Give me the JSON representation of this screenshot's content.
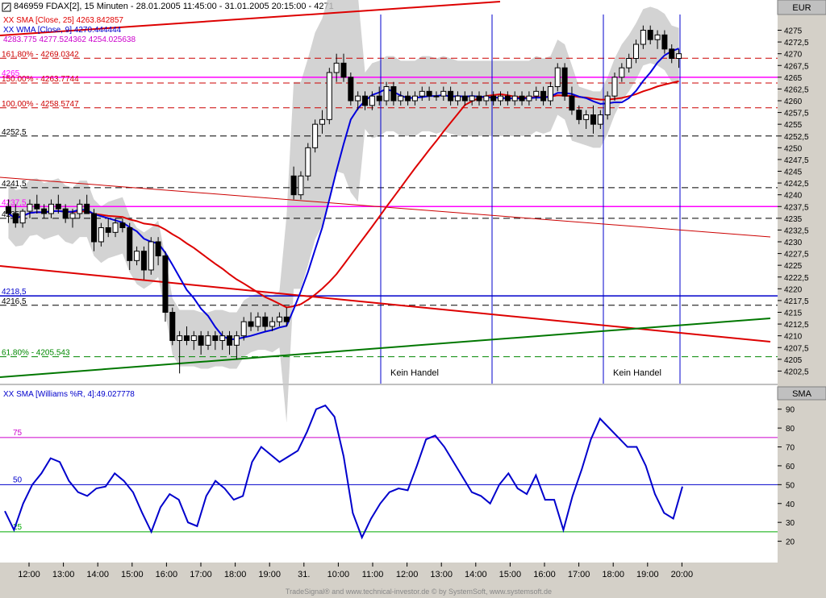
{
  "header": {
    "icon": "chart-icon",
    "title": "846959  FDAX[2], 15 Minuten - 28.01.2005 11:45:00 - 31.01.2005 20:15:00 - 4271"
  },
  "currency_label": "EUR",
  "lower_panel_label": "SMA",
  "footer_text": "TradeSignal® and www.technical-investor.de © by SystemSoft, www.systemsoft.de",
  "chart_data": [
    {
      "type": "candlestick",
      "panel": "price",
      "ylim": [
        4200,
        4278
      ],
      "y_ticks": [
        "4275",
        "4272,5",
        "4270",
        "4267,5",
        "4265",
        "4262,5",
        "4260",
        "4257,5",
        "4255",
        "4252,5",
        "4250",
        "4247,5",
        "4245",
        "4242,5",
        "4240",
        "4237,5",
        "4235",
        "4232,5",
        "4230",
        "4227,5",
        "4225",
        "4222,5",
        "4220",
        "4217,5",
        "4215",
        "4212,5",
        "4210",
        "4207,5",
        "4205",
        "4202,5"
      ],
      "y_tick_values": [
        4275,
        4272.5,
        4270,
        4267.5,
        4265,
        4262.5,
        4260,
        4257.5,
        4255,
        4252.5,
        4250,
        4247.5,
        4245,
        4242.5,
        4240,
        4237.5,
        4235,
        4232.5,
        4230,
        4227.5,
        4225,
        4222.5,
        4220,
        4217.5,
        4215,
        4212.5,
        4210,
        4207.5,
        4205,
        4202.5
      ],
      "indicator_labels": [
        {
          "text": "XX SMA [Close, 25] 4263.842857",
          "color": "#e00000"
        },
        {
          "text": "XX WMA [Close, 9] 4270.444444",
          "color": "#0000cc"
        },
        {
          "text": "4283.775  4277.524362  4254.025638",
          "color": "#cc00cc"
        }
      ],
      "levels": [
        {
          "value": 4269.0342,
          "label": "161,80% - 4269.0342",
          "color": "#cc0000",
          "style": "dash"
        },
        {
          "value": 4265,
          "label": "4265",
          "color": "#ff00ff",
          "style": "solid"
        },
        {
          "value": 4263.7744,
          "label": "150.00% - 4263.7744",
          "color": "#cc0000",
          "style": "dash"
        },
        {
          "value": 4258.5,
          "label": "100.00% - 4258.5747",
          "color": "#cc0000",
          "style": "dash"
        },
        {
          "value": 4252.5,
          "label": "4252,5",
          "color": "#000000",
          "style": "dash"
        },
        {
          "value": 4241.5,
          "label": "4241,5",
          "color": "#000000",
          "style": "dash"
        },
        {
          "value": 4237.5,
          "label": "4237,5",
          "color": "#ff00ff",
          "style": "solid"
        },
        {
          "value": 4235,
          "label": "4235",
          "color": "#000000",
          "style": "dash"
        },
        {
          "value": 4218.5,
          "label": "4218,5",
          "color": "#0000cc",
          "style": "solid"
        },
        {
          "value": 4216.5,
          "label": "4216,5",
          "color": "#000000",
          "style": "dash"
        },
        {
          "value": 4205.543,
          "label": "61.80% - 4205.543",
          "color": "#008800",
          "style": "dash"
        }
      ],
      "session_labels": [
        "Kein Handel",
        "Kein Handel"
      ],
      "candles": [
        [
          4237.5,
          4239,
          4234,
          4236
        ],
        [
          4236,
          4238,
          4233,
          4234
        ],
        [
          4234,
          4237,
          4233,
          4236.5
        ],
        [
          4236.5,
          4239,
          4235,
          4238
        ],
        [
          4238,
          4240,
          4236,
          4237
        ],
        [
          4237,
          4238,
          4235,
          4236
        ],
        [
          4236,
          4239,
          4235,
          4238
        ],
        [
          4238,
          4240,
          4236,
          4237
        ],
        [
          4237,
          4238,
          4234,
          4235
        ],
        [
          4235,
          4237,
          4233,
          4236
        ],
        [
          4236,
          4239,
          4235,
          4238
        ],
        [
          4238,
          4240,
          4236,
          4236
        ],
        [
          4236,
          4237,
          4228,
          4230
        ],
        [
          4230,
          4234,
          4229,
          4233
        ],
        [
          4233,
          4235,
          4231,
          4232
        ],
        [
          4232,
          4235,
          4231,
          4234
        ],
        [
          4234,
          4235,
          4232,
          4233
        ],
        [
          4233,
          4234,
          4224,
          4226
        ],
        [
          4226,
          4229,
          4225,
          4228
        ],
        [
          4228,
          4229,
          4222,
          4224
        ],
        [
          4224,
          4231,
          4223,
          4230
        ],
        [
          4230,
          4231,
          4225,
          4227
        ],
        [
          4227,
          4228,
          4213,
          4215
        ],
        [
          4215,
          4216,
          4208,
          4209
        ],
        [
          4209,
          4211,
          4202,
          4210
        ],
        [
          4210,
          4212,
          4208,
          4209
        ],
        [
          4209,
          4211,
          4207,
          4210
        ],
        [
          4210,
          4211,
          4206,
          4208
        ],
        [
          4208,
          4211,
          4207,
          4210
        ],
        [
          4210,
          4211,
          4207,
          4209
        ],
        [
          4209,
          4211,
          4207,
          4210
        ],
        [
          4210,
          4211,
          4206,
          4208
        ],
        [
          4208,
          4211,
          4205,
          4210
        ],
        [
          4210,
          4214,
          4209,
          4213
        ],
        [
          4213,
          4215,
          4211,
          4212
        ],
        [
          4212,
          4215,
          4211,
          4214
        ],
        [
          4214,
          4215,
          4211,
          4212
        ],
        [
          4212,
          4214,
          4211,
          4213
        ],
        [
          4213,
          4215,
          4212,
          4214
        ],
        [
          4214,
          4216,
          4212,
          4213
        ],
        [
          4244,
          4246,
          4239,
          4240
        ],
        [
          4240,
          4245,
          4239,
          4244
        ],
        [
          4244,
          4251,
          4243,
          4250
        ],
        [
          4250,
          4256,
          4249,
          4255
        ],
        [
          4255,
          4258,
          4253,
          4256
        ],
        [
          4256,
          4267,
          4255,
          4266
        ],
        [
          4266,
          4270,
          4264,
          4268
        ],
        [
          4268,
          4270,
          4264,
          4265
        ],
        [
          4265,
          4266,
          4259,
          4260
        ],
        [
          4260,
          4262,
          4258,
          4261
        ],
        [
          4261,
          4262,
          4258,
          4259
        ],
        [
          4259,
          4262,
          4258,
          4261
        ],
        [
          4261,
          4263,
          4259,
          4260
        ],
        [
          4260,
          4264,
          4259,
          4263
        ],
        [
          4263,
          4264,
          4259,
          4260
        ],
        [
          4260,
          4262,
          4259,
          4261
        ],
        [
          4261,
          4262,
          4259,
          4260
        ],
        [
          4260,
          4262,
          4259,
          4261
        ],
        [
          4261,
          4263,
          4260,
          4262
        ],
        [
          4262,
          4263,
          4260,
          4261
        ],
        [
          4261,
          4262,
          4260,
          4261
        ],
        [
          4261,
          4263,
          4260,
          4262
        ],
        [
          4262,
          4263,
          4259,
          4260
        ],
        [
          4260,
          4262,
          4259,
          4261
        ],
        [
          4261,
          4262,
          4259,
          4260
        ],
        [
          4260,
          4262,
          4259,
          4261
        ],
        [
          4261,
          4262,
          4259,
          4260
        ],
        [
          4260,
          4262,
          4259,
          4261
        ],
        [
          4261,
          4262,
          4259,
          4260
        ],
        [
          4260,
          4262,
          4259,
          4261
        ],
        [
          4261,
          4262,
          4259,
          4260
        ],
        [
          4260,
          4262,
          4259,
          4261
        ],
        [
          4261,
          4262,
          4259,
          4260
        ],
        [
          4260,
          4262,
          4259,
          4261
        ],
        [
          4261,
          4263,
          4260,
          4262
        ],
        [
          4262,
          4263,
          4259,
          4260
        ],
        [
          4260,
          4264,
          4259,
          4263
        ],
        [
          4263,
          4268,
          4262,
          4267
        ],
        [
          4267,
          4268,
          4260,
          4261
        ],
        [
          4261,
          4263,
          4257,
          4258
        ],
        [
          4258,
          4259,
          4255,
          4256
        ],
        [
          4256,
          4258,
          4254,
          4257
        ],
        [
          4257,
          4259,
          4253,
          4255
        ],
        [
          4255,
          4258,
          4254,
          4257
        ],
        [
          4257,
          4262,
          4256,
          4261
        ],
        [
          4261,
          4266,
          4260,
          4265
        ],
        [
          4265,
          4268,
          4264,
          4267
        ],
        [
          4267,
          4270,
          4266,
          4269
        ],
        [
          4269,
          4273,
          4268,
          4272
        ],
        [
          4272,
          4276,
          4271,
          4275
        ],
        [
          4275,
          4276,
          4272,
          4273
        ],
        [
          4273,
          4275,
          4271,
          4274
        ],
        [
          4274,
          4275,
          4270,
          4271
        ],
        [
          4271,
          4272,
          4268,
          4269
        ],
        [
          4269,
          4271,
          4267,
          4270
        ]
      ]
    },
    {
      "type": "line",
      "panel": "oscillator",
      "label": "XX SMA [Williams %R, 4]:49.027778",
      "ylim": [
        10,
        95
      ],
      "y_ticks": [
        "90",
        "80",
        "70",
        "60",
        "50",
        "40",
        "30",
        "20"
      ],
      "y_tick_values": [
        90,
        80,
        70,
        60,
        50,
        40,
        30,
        20
      ],
      "levels": [
        {
          "value": 75,
          "label": "75",
          "color": "#cc00cc"
        },
        {
          "value": 50,
          "label": "50",
          "color": "#0000cc"
        },
        {
          "value": 25,
          "label": "25",
          "color": "#00aa00"
        }
      ],
      "series": [
        {
          "color": "#0000cc",
          "values": [
            36,
            26,
            40,
            50,
            56,
            64,
            62,
            52,
            46,
            44,
            48,
            49,
            56,
            52,
            46,
            35,
            25,
            38,
            45,
            42,
            30,
            28,
            44,
            52,
            48,
            42,
            44,
            62,
            70,
            66,
            62,
            65,
            68,
            78,
            90,
            92,
            86,
            65,
            35,
            22,
            32,
            40,
            46,
            48,
            47,
            60,
            74,
            76,
            70,
            62,
            54,
            46,
            44,
            40,
            50,
            56,
            48,
            45,
            55,
            42,
            42,
            26,
            44,
            58,
            74,
            85,
            80,
            75,
            70,
            70,
            60,
            45,
            35,
            32,
            49
          ]
        }
      ]
    }
  ],
  "x_ticks": [
    "12:00",
    "13:00",
    "14:00",
    "15:00",
    "16:00",
    "17:00",
    "18:00",
    "19:00",
    "31.",
    "10:00",
    "11:00",
    "12:00",
    "13:00",
    "14:00",
    "15:00",
    "16:00",
    "17:00",
    "18:00",
    "19:00",
    "20:00"
  ]
}
